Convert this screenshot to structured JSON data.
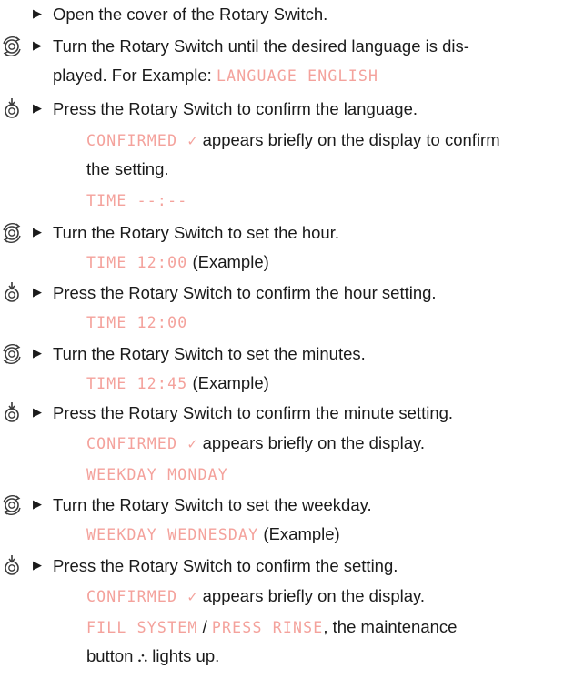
{
  "colors": {
    "text": "#1b1b1b",
    "display": "#f4a29c",
    "icon": "#3a3a3a"
  },
  "steps": [
    {
      "icon": "none",
      "text": "Open the cover of the Rotary Switch."
    },
    {
      "icon": "rotate-icon",
      "text_a": "Turn the Rotary Switch until the desired language is dis-",
      "text_b": "played. For Example:",
      "display": "LANGUAGE ENGLISH"
    },
    {
      "icon": "press-icon",
      "text": "Press the Rotary Switch to confirm the language.",
      "display": "CONFIRMED ✓",
      "note_a": "appears briefly on the display to confirm",
      "note_b": "the setting.",
      "display2": "TIME --:--"
    },
    {
      "icon": "rotate-icon",
      "text": "Turn the Rotary Switch to set the hour.",
      "display": "TIME 12:00",
      "suffix": "(Example)"
    },
    {
      "icon": "press-icon",
      "text": "Press the Rotary Switch to confirm the hour setting.",
      "display": "TIME 12:00"
    },
    {
      "icon": "rotate-icon",
      "text": "Turn the Rotary Switch to set the minutes.",
      "display": "TIME 12:45",
      "suffix": "(Example)"
    },
    {
      "icon": "press-icon",
      "text": "Press the Rotary Switch to confirm the minute setting.",
      "display": "CONFIRMED ✓",
      "note": "appears briefly on the display.",
      "display2": "WEEKDAY MONDAY"
    },
    {
      "icon": "rotate-icon",
      "text": "Turn the Rotary Switch to set the weekday.",
      "display": "WEEKDAY WEDNESDAY",
      "suffix": "(Example)"
    },
    {
      "icon": "press-icon",
      "text": "Press the Rotary Switch to confirm the setting.",
      "display": "CONFIRMED ✓",
      "note": "appears briefly on the display.",
      "display2a": "FILL SYSTEM",
      "sep": "/",
      "display2b": "PRESS RINSE",
      "note2": ", the maintenance",
      "note3a": "button",
      "maint_icon": "⛬",
      "note3b": "lights up."
    }
  ]
}
